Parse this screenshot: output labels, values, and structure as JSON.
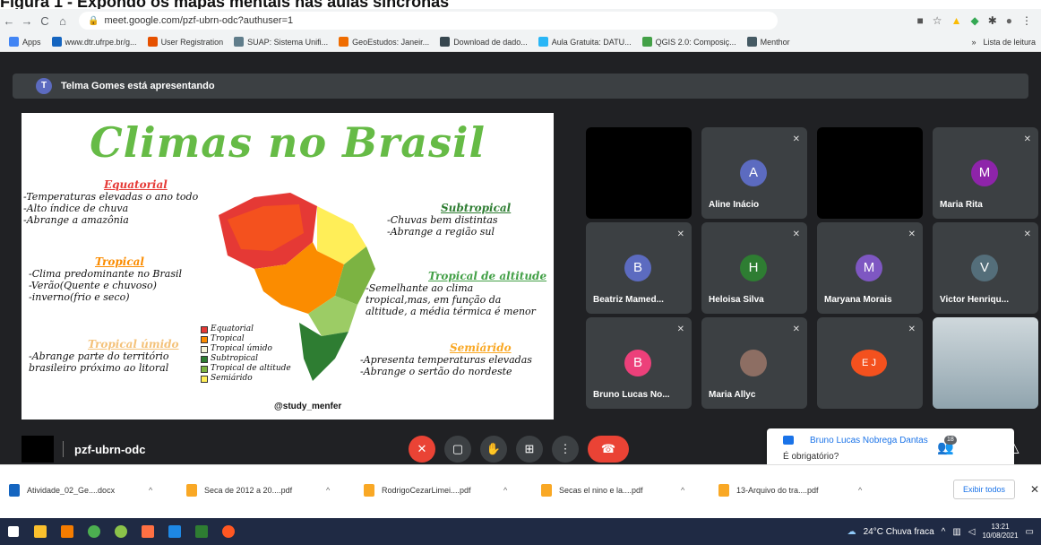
{
  "caption": "Figura 1 - Expondo os mapas mentais nas aulas síncronas",
  "browser": {
    "back": "←",
    "forward": "→",
    "reload": "C",
    "home": "⌂",
    "url": "meet.google.com/pzf-ubrn-odc?authuser=1",
    "more": "⋮"
  },
  "bookmarks": {
    "items": [
      {
        "label": "Apps",
        "color": "#4285f4"
      },
      {
        "label": "www.dtr.ufrpe.br/g...",
        "color": "#1565c0"
      },
      {
        "label": "User Registration",
        "color": "#e65100"
      },
      {
        "label": "SUAP: Sistema Unifi...",
        "color": "#607d8b"
      },
      {
        "label": "GeoEstudos: Janeir...",
        "color": "#ef6c00"
      },
      {
        "label": "Download de dado...",
        "color": "#37474f"
      },
      {
        "label": "Aula Gratuita: DATU...",
        "color": "#29b6f6"
      },
      {
        "label": "QGIS 2.0: Composiç...",
        "color": "#43a047"
      },
      {
        "label": "Menthor",
        "color": "#455a64"
      }
    ],
    "overflow": "»",
    "reading_list": "Lista de leitura"
  },
  "meet": {
    "presenter_initial": "T",
    "presenter_banner": "Telma Gomes está apresentando",
    "slide": {
      "title": "Climas no Brasil",
      "equatorial": {
        "head": "Equatorial",
        "lines": [
          "-Temperaturas elevadas o ano todo",
          "-Alto índice de chuva",
          "-Abrange a amazônia"
        ]
      },
      "tropical": {
        "head": "Tropical",
        "lines": [
          "-Clima predominante no Brasil",
          "-Verão(Quente e chuvoso)",
          "-inverno(frio e seco)"
        ]
      },
      "tropical_umido": {
        "head": "Tropical úmido",
        "lines": [
          "-Abrange parte do território",
          "brasileiro próximo ao litoral"
        ]
      },
      "subtropical": {
        "head": "Subtropical",
        "lines": [
          "-Chuvas bem distintas",
          "-Abrange a região sul"
        ]
      },
      "tropical_altitude": {
        "head": "Tropical de altitude",
        "lines": [
          "-Semelhante ao clima",
          "tropical,mas, em função da",
          "altitude, a média térmica é menor"
        ]
      },
      "semiarido": {
        "head": "Semiárido",
        "lines": [
          "-Apresenta temperaturas elevadas",
          "-Abrange o sertão do nordeste"
        ]
      },
      "legend": [
        {
          "label": "Equatorial",
          "color": "#e53935"
        },
        {
          "label": "Tropical",
          "color": "#fb8c00"
        },
        {
          "label": "Tropical úmido",
          "color": "#f5f5dc"
        },
        {
          "label": "Subtropical",
          "color": "#2e7d32"
        },
        {
          "label": "Tropical de altitude",
          "color": "#7cb342"
        },
        {
          "label": "Semiárido",
          "color": "#ffee58"
        }
      ],
      "credit": "@study_menfer"
    },
    "participants": [
      {
        "name": "",
        "initial": "",
        "color": "",
        "type": "black"
      },
      {
        "name": "Aline Inácio",
        "initial": "A",
        "color": "#5c6bc0",
        "type": "avatar"
      },
      {
        "name": "",
        "initial": "",
        "color": "",
        "type": "black"
      },
      {
        "name": "Maria Rita",
        "initial": "M",
        "color": "#8e24aa",
        "type": "avatar"
      },
      {
        "name": "Beatriz Mamed...",
        "initial": "B",
        "color": "#5c6bc0",
        "type": "avatar"
      },
      {
        "name": "Heloisa Silva",
        "initial": "H",
        "color": "#2e7d32",
        "type": "avatar"
      },
      {
        "name": "Maryana Morais",
        "initial": "M",
        "color": "#7e57c2",
        "type": "avatar"
      },
      {
        "name": "Victor Henriqu...",
        "initial": "V",
        "color": "#546e7a",
        "type": "avatar"
      },
      {
        "name": "Bruno Lucas No...",
        "initial": "B",
        "color": "#ec407a",
        "type": "avatar"
      },
      {
        "name": "Maria Allyc",
        "initial": "",
        "color": "#8d6e63",
        "type": "photo"
      },
      {
        "name": "",
        "initial": "E J",
        "color": "#f4511e",
        "type": "group"
      },
      {
        "name": "",
        "initial": "",
        "color": "#cfd8dc",
        "type": "video"
      }
    ],
    "chat": {
      "sender": "Bruno Lucas Nobrega Dantas",
      "message": "É obrigatório?"
    },
    "meeting_code": "pzf-ubrn-odc",
    "people_count": "18"
  },
  "downloads": {
    "items": [
      {
        "name": "Atividade_02_Ge....docx",
        "color": "#1565c0"
      },
      {
        "name": "Seca de 2012 a 20....pdf",
        "color": "#f9a825"
      },
      {
        "name": "RodrigoCezarLimei....pdf",
        "color": "#f9a825"
      },
      {
        "name": "Secas el nino e la....pdf",
        "color": "#f9a825"
      },
      {
        "name": "13-Arquivo do tra....pdf",
        "color": "#f9a825"
      }
    ],
    "show_all": "Exibir todos",
    "close": "✕"
  },
  "taskbar": {
    "weather": "24°C Chuva fraca",
    "time": "13:21",
    "date": "10/08/2021"
  }
}
